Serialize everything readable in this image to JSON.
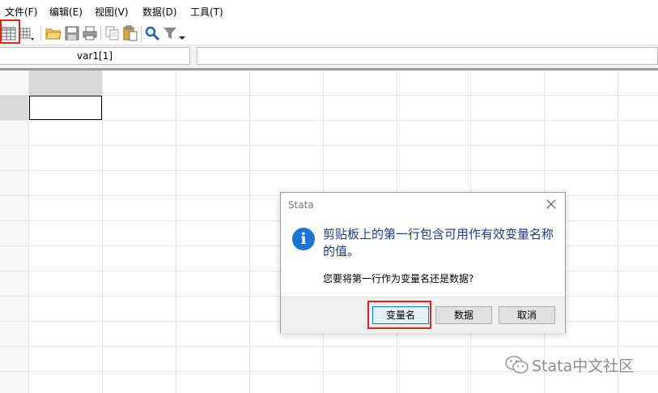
{
  "menu": {
    "items": [
      "文件(F)",
      "编辑(E)",
      "视图(V)",
      "数据(D)",
      "工具(T)"
    ]
  },
  "toolbar": {
    "icons": [
      "data-editor-icon",
      "variables-manager-icon",
      "open-folder-icon",
      "save-icon",
      "print-icon",
      "copy-icon",
      "paste-icon",
      "find-icon",
      "filter-icon"
    ]
  },
  "cellbar": {
    "name_box": "var1[1]",
    "edit_value": ""
  },
  "dialog": {
    "title": "Stata",
    "info_glyph": "i",
    "message": "剪贴板上的第一行包含可用作有效变量名称的值。",
    "question": "您要将第一行作为变量名还是数据?",
    "buttons": {
      "varnames": "变量名",
      "data": "数据",
      "cancel": "取消"
    }
  },
  "watermark": {
    "text": "Stata中文社区"
  },
  "colors": {
    "highlight_red": "#e0241b",
    "info_blue": "#1a74d2",
    "message_text": "#1f3a8a"
  }
}
